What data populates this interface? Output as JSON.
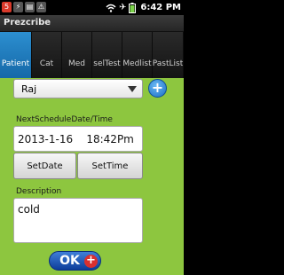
{
  "status_bar": {
    "time": "6:42 PM",
    "left_icons": [
      "notification-icon",
      "usb-icon",
      "sd-icon",
      "debug-icon"
    ],
    "right_icons": [
      "wifi-icon",
      "airplane-icon",
      "battery-icon"
    ]
  },
  "app": {
    "title": "Prezcribe"
  },
  "tabs": [
    {
      "label": "Patient",
      "active": true
    },
    {
      "label": "Cat",
      "active": false
    },
    {
      "label": "Med",
      "active": false
    },
    {
      "label": "selTest",
      "active": false
    },
    {
      "label": "Medlist",
      "active": false
    },
    {
      "label": "PastList",
      "active": false
    }
  ],
  "form": {
    "patient_selected": "Raj",
    "next_schedule_label": "NextScheduleDate/Time",
    "next_schedule_value": "2013-1-16    18:42Pm",
    "set_date_label": "SetDate",
    "set_time_label": "SetTime",
    "description_label": "Description",
    "description_value": "cold",
    "ok_label": "OK"
  },
  "colors": {
    "background": "#8dc63f",
    "active_tab": "#1f7cc0",
    "ok_button": "#1a4fb0",
    "ok_plus": "#d9302f"
  }
}
